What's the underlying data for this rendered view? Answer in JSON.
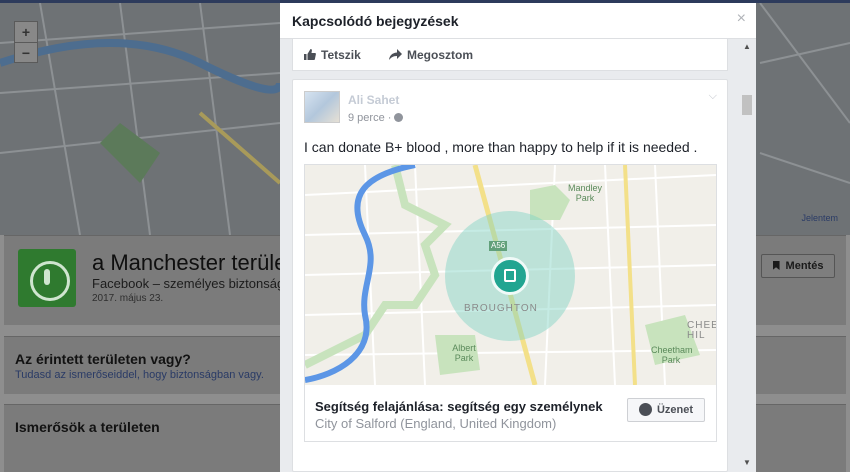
{
  "background": {
    "map_controls": {
      "zoom_in": "+",
      "zoom_out": "−"
    },
    "map_report": "Jelentem",
    "title": "a Manchester területé",
    "subtitle": "Facebook – személyes biztonság",
    "date": "2017. május 23.",
    "save_label": "Mentés",
    "affected_question": "Az érintett területen vagy?",
    "affected_hint": "Tudasd az ismerőseiddel, hogy biztonságban vagy.",
    "friends_heading": "Ismerősök a területen"
  },
  "modal": {
    "title": "Kapcsolódó bejegyzések",
    "close_glyph": "×",
    "like_label": "Tetszik",
    "share_label": "Megosztom"
  },
  "post": {
    "author": "Ali Sahet",
    "time": "9 perce ·",
    "text": "I can donate B+ blood , more than happy to help if it is needed .",
    "map": {
      "labels": {
        "mandley_park": "Mandley Park",
        "broughton": "BROUGHTON",
        "albert_park": "Albert Park",
        "cheetham_park": "Cheetham Park",
        "cheet": "CHEET HIL",
        "road": "A56"
      }
    },
    "attachment_title": "Segítség felajánlása: segítség egy személynek",
    "attachment_location": "City of Salford (England, United Kingdom)",
    "message_button": "Üzenet"
  },
  "colors": {
    "facebook_blue": "#4267b2",
    "accent_teal": "#21a591",
    "map_park": "#c8e3bd",
    "map_water": "#5c96e6"
  }
}
